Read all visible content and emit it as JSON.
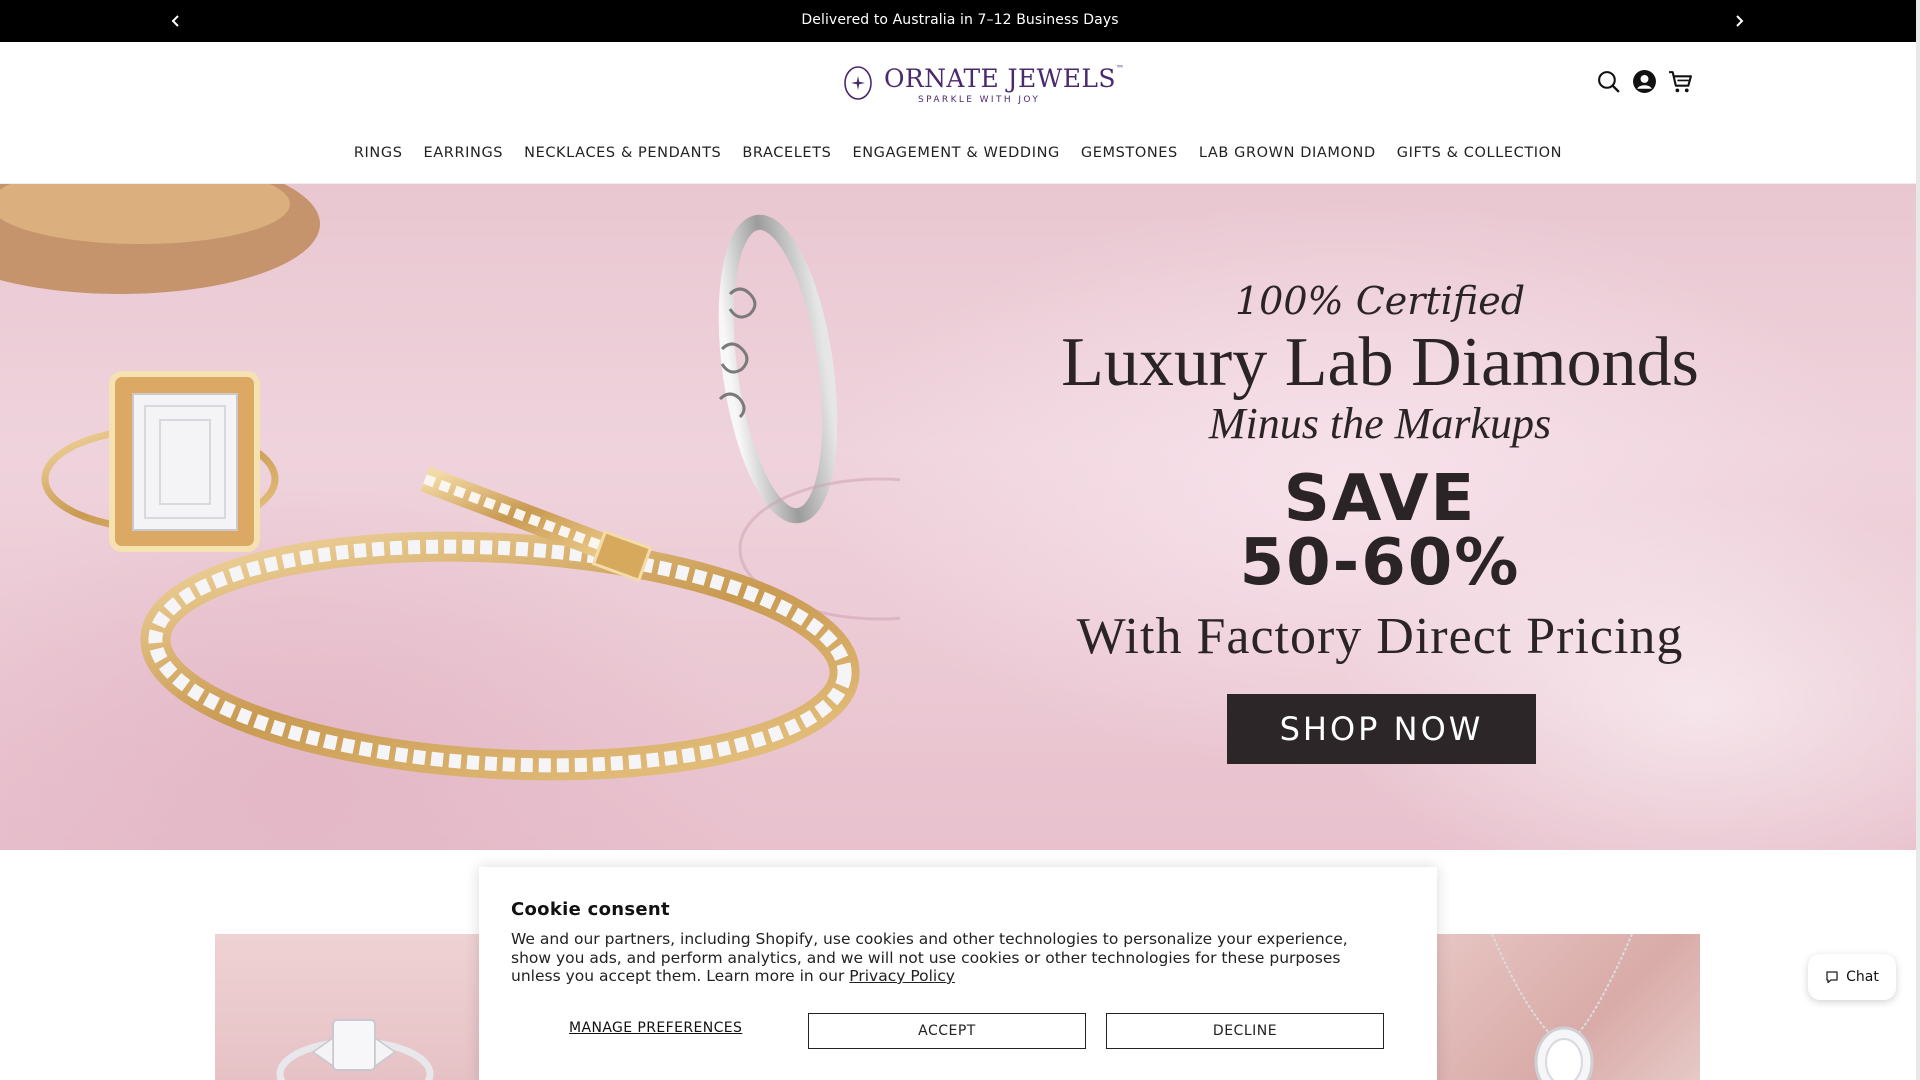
{
  "announcement": {
    "message": "Delivered to Australia in 7–12 Business Days",
    "prev_icon": "chevron-left-icon",
    "next_icon": "chevron-right-icon"
  },
  "header": {
    "logo": {
      "brand": "ORNATE JEWELS",
      "tm": "™",
      "tagline": "SPARKLE WITH JOY"
    },
    "icons": [
      "search-icon",
      "account-icon",
      "cart-icon"
    ],
    "nav": [
      "RINGS",
      "EARRINGS",
      "NECKLACES & PENDANTS",
      "BRACELETS",
      "ENGAGEMENT & WEDDING",
      "GEMSTONES",
      "LAB GROWN DIAMOND",
      "GIFTS & COLLECTION"
    ]
  },
  "hero": {
    "line1": "100% Certified",
    "line2": "Luxury Lab Diamonds",
    "line3": "Minus the Markups",
    "line4": "SAVE",
    "line5": "50-60%",
    "line6": "With Factory Direct Pricing",
    "cta": "SHOP NOW"
  },
  "cookie": {
    "title": "Cookie consent",
    "body": "We and our partners, including Shopify, use cookies and other technologies to personalize your experience, show you ads, and perform analytics, and we will not use cookies or other technologies for these purposes unless you accept them. Learn more in our ",
    "link": "Privacy Policy",
    "manage": "MANAGE PREFERENCES",
    "accept": "ACCEPT",
    "decline": "DECLINE"
  },
  "chat": {
    "label": "Chat",
    "icon": "chat-bubble-icon"
  },
  "colors": {
    "brand": "#4a2a6e",
    "cta_bg": "#2c2629",
    "announce_bg": "#000000"
  }
}
